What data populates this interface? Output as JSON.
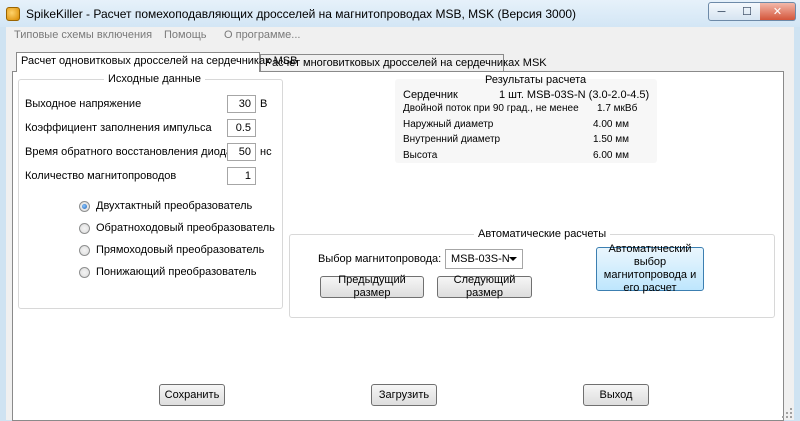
{
  "window": {
    "title": "SpikeKiller - Расчет помехоподавляющих дросселей на магнитопроводах MSB, MSK (Версия 3000)",
    "minimize_glyph": "─",
    "maximize_glyph": "☐",
    "close_glyph": "✕"
  },
  "menu": [
    "Типовые схемы включения",
    "Помощь",
    "О программе..."
  ],
  "tabs": [
    {
      "label": "Расчет одновитковых дросселей на сердечниках MSB",
      "active": true
    },
    {
      "label": "Расчет многовитковых дросселей на сердечниках MSK",
      "active": false
    }
  ],
  "input_group": {
    "title": "Исходные данные",
    "fields": [
      {
        "label": "Выходное напряжение",
        "value": "30",
        "unit": "В"
      },
      {
        "label": "Коэффициент заполнения импульса",
        "value": "0.5",
        "unit": ""
      },
      {
        "label": "Время обратного восстановления диода",
        "value": "50",
        "unit": "нс"
      },
      {
        "label": "Количество магнитопроводов",
        "value": "1",
        "unit": ""
      }
    ],
    "converter_types": [
      {
        "label": "Двухтактный преобразователь",
        "selected": true
      },
      {
        "label": "Обратноходовый преобразователь",
        "selected": false
      },
      {
        "label": "Прямоходовый преобразователь",
        "selected": false
      },
      {
        "label": "Понижающий преобразователь",
        "selected": false
      }
    ]
  },
  "results_group": {
    "title": "Результаты расчета",
    "rows": [
      {
        "label": "Сердечник",
        "value": "1 шт. MSB-03S-N (3.0-2.0-4.5)"
      },
      {
        "label": "Двойной поток при 90 град., не менее",
        "value": "1.7 мкВб"
      },
      {
        "label": "Наружный диаметр",
        "value": "4.00 мм"
      },
      {
        "label": "Внутренний диаметр",
        "value": "1.50 мм"
      },
      {
        "label": "Высота",
        "value": "6.00 мм"
      }
    ]
  },
  "auto_group": {
    "title": "Автоматические расчеты",
    "core_select_label": "Выбор магнитопровода:",
    "core_select_value": "MSB-03S-N",
    "prev_button": "Предыдущий размер",
    "next_button": "Следующий размер",
    "auto_button": "Автоматический выбор магнитопровода и его расчет"
  },
  "footer": {
    "save": "Сохранить",
    "load": "Загрузить",
    "exit": "Выход"
  }
}
